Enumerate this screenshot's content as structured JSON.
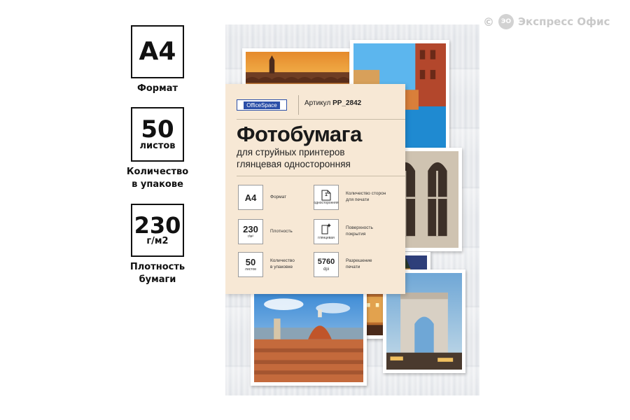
{
  "watermark": {
    "copyright": "©",
    "text": "Экспресс Офис"
  },
  "specs": [
    {
      "big": "A4",
      "small": "",
      "caption": "Формат"
    },
    {
      "big": "50",
      "small": "листов",
      "caption_line1": "Количество",
      "caption_line2": "в упакове"
    },
    {
      "big": "230",
      "small": "г/м2",
      "caption_line1": "Плотность",
      "caption_line2": "бумаги"
    }
  ],
  "package": {
    "brand": "OfficeSpace",
    "article_label": "Артикул",
    "article_code": "PP_2842",
    "title": "Фотобумага",
    "subtitle_line1": "для струйных принтеров",
    "subtitle_line2": "глянцевая односторонняя",
    "features": [
      {
        "value": "A4",
        "unit": "",
        "label_line1": "Формат",
        "label_line2": ""
      },
      {
        "value": "230",
        "unit": "г/м²",
        "label_line1": "Плотность",
        "label_line2": ""
      },
      {
        "value": "50",
        "unit": "листов",
        "label_line1": "Количество",
        "label_line2": "в упаковке"
      },
      {
        "value": "1",
        "unit": "односторонняя",
        "label_line1": "Количество сторон",
        "label_line2": "для печати"
      },
      {
        "value": "",
        "unit": "глянцевая",
        "label_line1": "Поверхность",
        "label_line2": "покрытия"
      },
      {
        "value": "5760",
        "unit": "dpi",
        "label_line1": "Разрешение",
        "label_line2": "печати"
      }
    ]
  },
  "colors": {
    "card": "#f7e8d5",
    "brand_blue": "#2b4fa8",
    "watermark": "#c9c9c9"
  }
}
